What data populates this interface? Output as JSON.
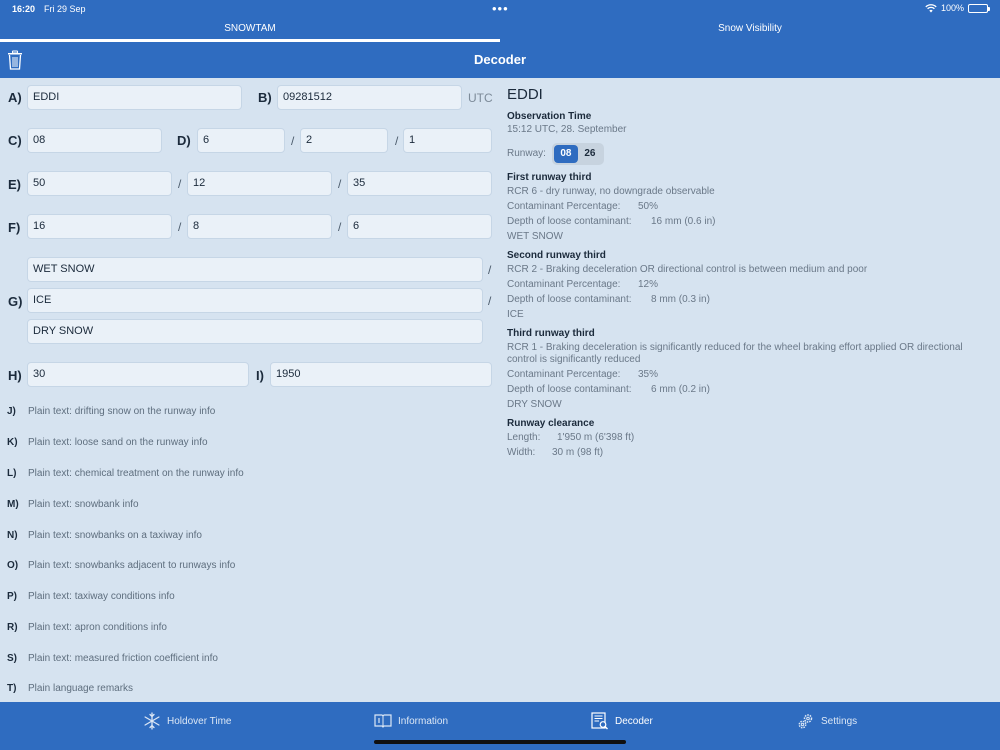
{
  "status": {
    "time": "16:20",
    "date": "Fri 29 Sep",
    "battery": "100%"
  },
  "tabs": [
    {
      "label": "SNOWTAM"
    },
    {
      "label": "Snow Visibility"
    }
  ],
  "header": {
    "title": "Decoder"
  },
  "form": {
    "A": {
      "label": "A)",
      "value": "EDDI"
    },
    "B": {
      "label": "B)",
      "value": "09281512",
      "unit": "UTC"
    },
    "C": {
      "label": "C)",
      "value": "08"
    },
    "D": {
      "label": "D)",
      "values": [
        "6",
        "2",
        "1"
      ]
    },
    "E": {
      "label": "E)",
      "values": [
        "50",
        "12",
        "35"
      ]
    },
    "F": {
      "label": "F)",
      "values": [
        "16",
        "8",
        "6"
      ]
    },
    "G": {
      "label": "G)",
      "values": [
        "WET SNOW",
        "ICE",
        "DRY SNOW"
      ]
    },
    "H": {
      "label": "H)",
      "value": "30"
    },
    "I": {
      "label": "I)",
      "value": "1950"
    },
    "sep": "/"
  },
  "plain": [
    {
      "label": "J)",
      "text": "Plain text: drifting snow on the runway info"
    },
    {
      "label": "K)",
      "text": "Plain text: loose sand on the runway info"
    },
    {
      "label": "L)",
      "text": "Plain text: chemical treatment on the runway info"
    },
    {
      "label": "M)",
      "text": "Plain text: snowbank info"
    },
    {
      "label": "N)",
      "text": "Plain text: snowbanks on a taxiway info"
    },
    {
      "label": "O)",
      "text": "Plain text: snowbanks adjacent to runways info"
    },
    {
      "label": "P)",
      "text": "Plain text: taxiway conditions info"
    },
    {
      "label": "R)",
      "text": "Plain text: apron conditions info"
    },
    {
      "label": "S)",
      "text": "Plain text: measured friction coefficient info"
    },
    {
      "label": "T)",
      "text": "Plain language remarks"
    }
  ],
  "decoded": {
    "airport": "EDDI",
    "obs_title": "Observation Time",
    "obs_value": "15:12 UTC, 28. September",
    "runway_label": "Runway:",
    "runways": [
      "08",
      "26"
    ],
    "thirds": [
      {
        "title": "First runway third",
        "rcr": "RCR 6 - dry runway, no downgrade observable",
        "pct_label": "Contaminant Percentage:",
        "pct_value": "50%",
        "depth_label": "Depth of loose contaminant:",
        "depth_value": "16 mm (0.6 in)",
        "type": "WET SNOW"
      },
      {
        "title": "Second runway third",
        "rcr": "RCR 2 - Braking deceleration OR directional control is between medium and poor",
        "pct_label": "Contaminant Percentage:",
        "pct_value": "12%",
        "depth_label": "Depth of loose contaminant:",
        "depth_value": "8 mm (0.3 in)",
        "type": "ICE"
      },
      {
        "title": "Third runway third",
        "rcr": "RCR 1 - Braking deceleration is significantly reduced for the wheel braking effort applied OR directional control is significantly reduced",
        "pct_label": "Contaminant Percentage:",
        "pct_value": "35%",
        "depth_label": "Depth of loose contaminant:",
        "depth_value": "6 mm (0.2 in)",
        "type": "DRY SNOW"
      }
    ],
    "clearance": {
      "title": "Runway clearance",
      "length_label": "Length:",
      "length_value": "1'950 m (6'398 ft)",
      "width_label": "Width:",
      "width_value": "30 m (98 ft)"
    }
  },
  "bottom_tabs": [
    {
      "label": "Holdover Time",
      "icon": "snowflake-icon"
    },
    {
      "label": "Information",
      "icon": "book-icon"
    },
    {
      "label": "Decoder",
      "icon": "decoder-icon"
    },
    {
      "label": "Settings",
      "icon": "gears-icon"
    }
  ]
}
